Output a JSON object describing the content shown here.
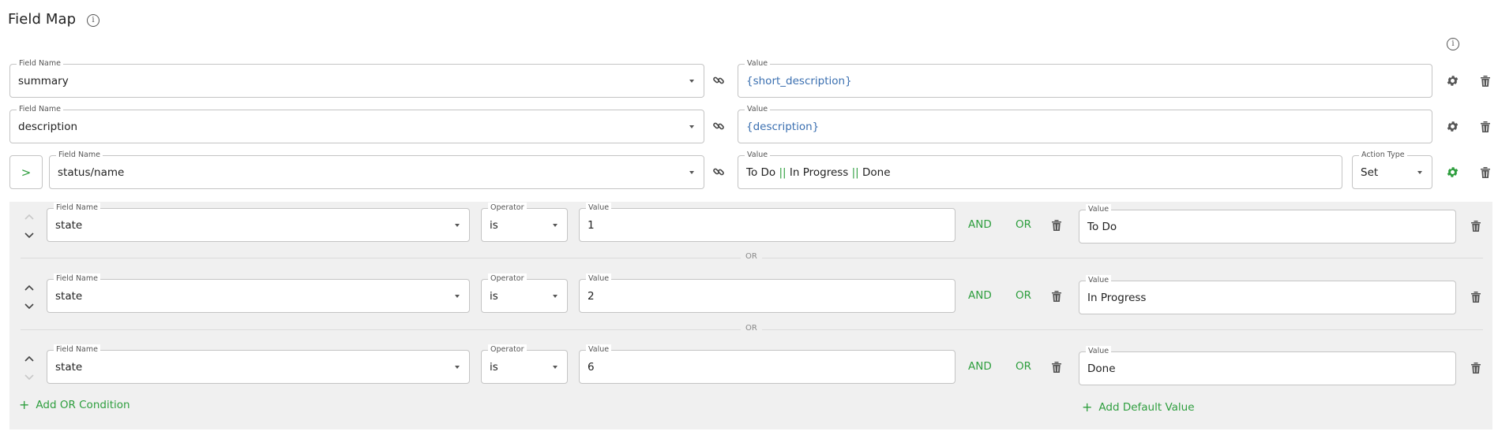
{
  "header": {
    "title": "Field Map",
    "info_glyph": "i"
  },
  "mappings": [
    {
      "field_label": "Field Name",
      "field_value": "summary",
      "value_label": "Value",
      "value": "{short_description}"
    },
    {
      "field_label": "Field Name",
      "field_value": "description",
      "value_label": "Value",
      "value": "{description}"
    },
    {
      "field_label": "Field Name",
      "field_value": "status/name",
      "value_label": "Value",
      "value_parts": [
        "To Do",
        "||",
        "In Progress",
        "||",
        "Done"
      ],
      "action_label": "Action Type",
      "action_value": "Set",
      "expand_glyph": ">"
    }
  ],
  "conditions": [
    {
      "field_label": "Field Name",
      "field_value": "state",
      "operator_label": "Operator",
      "operator_value": "is",
      "value_label": "Value",
      "value": "1",
      "and_label": "AND",
      "or_label": "OR",
      "result_label": "Value",
      "result_value": "To Do"
    },
    {
      "field_label": "Field Name",
      "field_value": "state",
      "operator_label": "Operator",
      "operator_value": "is",
      "value_label": "Value",
      "value": "2",
      "and_label": "AND",
      "or_label": "OR",
      "result_label": "Value",
      "result_value": "In Progress"
    },
    {
      "field_label": "Field Name",
      "field_value": "state",
      "operator_label": "Operator",
      "operator_value": "is",
      "value_label": "Value",
      "value": "6",
      "and_label": "AND",
      "or_label": "OR",
      "result_label": "Value",
      "result_value": "Done"
    }
  ],
  "separators": [
    "OR",
    "OR"
  ],
  "actions": {
    "add_or_condition": "Add OR Condition",
    "add_default_value": "Add Default Value",
    "plus_glyph": "+"
  },
  "colors": {
    "accent_green": "#2e9e3e",
    "value_blue": "#3a6fb0",
    "panel_bg": "#f0f0f0",
    "border": "#c4c4c4"
  }
}
